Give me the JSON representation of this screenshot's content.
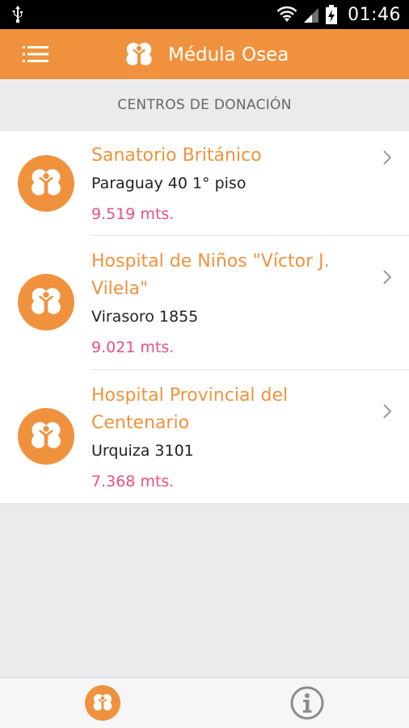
{
  "status_bar": {
    "time": "01:46"
  },
  "app_bar": {
    "title": "Médula Osea"
  },
  "section": {
    "title": "CENTROS DE DONACIÓN"
  },
  "centers": [
    {
      "name": "Sanatorio Británico",
      "address": "Paraguay 40 1° piso",
      "distance": "9.519 mts."
    },
    {
      "name": "Hospital de Niños \"Víctor J. Vilela\"",
      "address": "Virasoro 1855",
      "distance": "9.021 mts."
    },
    {
      "name": "Hospital Provincial del Centenario",
      "address": "Urquiza 3101",
      "distance": "7.368 mts."
    }
  ],
  "colors": {
    "primary": "#f0923d",
    "distance": "#ec4f83",
    "background": "#ebebed"
  },
  "icons": {
    "menu": "menu-icon",
    "brand": "clover-logo-icon",
    "chevron": "chevron-right-icon",
    "info": "info-icon"
  }
}
